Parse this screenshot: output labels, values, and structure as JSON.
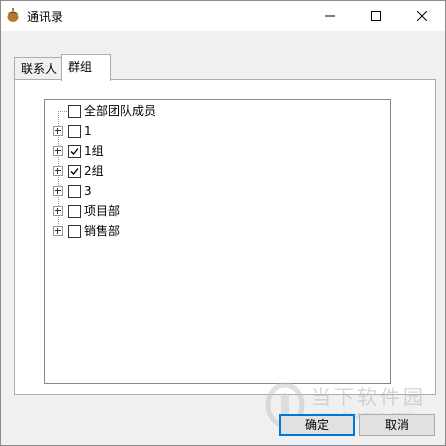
{
  "window": {
    "title": "通讯录",
    "icon": "acorn-icon",
    "controls": [
      "minimize-icon",
      "maximize-icon",
      "close-icon"
    ]
  },
  "tabs": [
    {
      "label": "联系人",
      "active": false
    },
    {
      "label": "群组",
      "active": true
    }
  ],
  "tree": {
    "items": [
      {
        "label": "全部团队成员",
        "checked": false,
        "expandable": false
      },
      {
        "label": "1",
        "checked": false,
        "expandable": true
      },
      {
        "label": "1组",
        "checked": true,
        "expandable": true
      },
      {
        "label": "2组",
        "checked": true,
        "expandable": true
      },
      {
        "label": "3",
        "checked": false,
        "expandable": true
      },
      {
        "label": "项目部",
        "checked": false,
        "expandable": true
      },
      {
        "label": "销售部",
        "checked": false,
        "expandable": true
      }
    ]
  },
  "buttons": {
    "ok_label": "确定",
    "cancel_label": "取消"
  },
  "watermark": {
    "text": "当下软件园",
    "url": "www.downxia.com"
  },
  "colors": {
    "focus_border": "#0078d7",
    "panel_bg": "#ffffff",
    "window_bg": "#f0f0f0"
  }
}
